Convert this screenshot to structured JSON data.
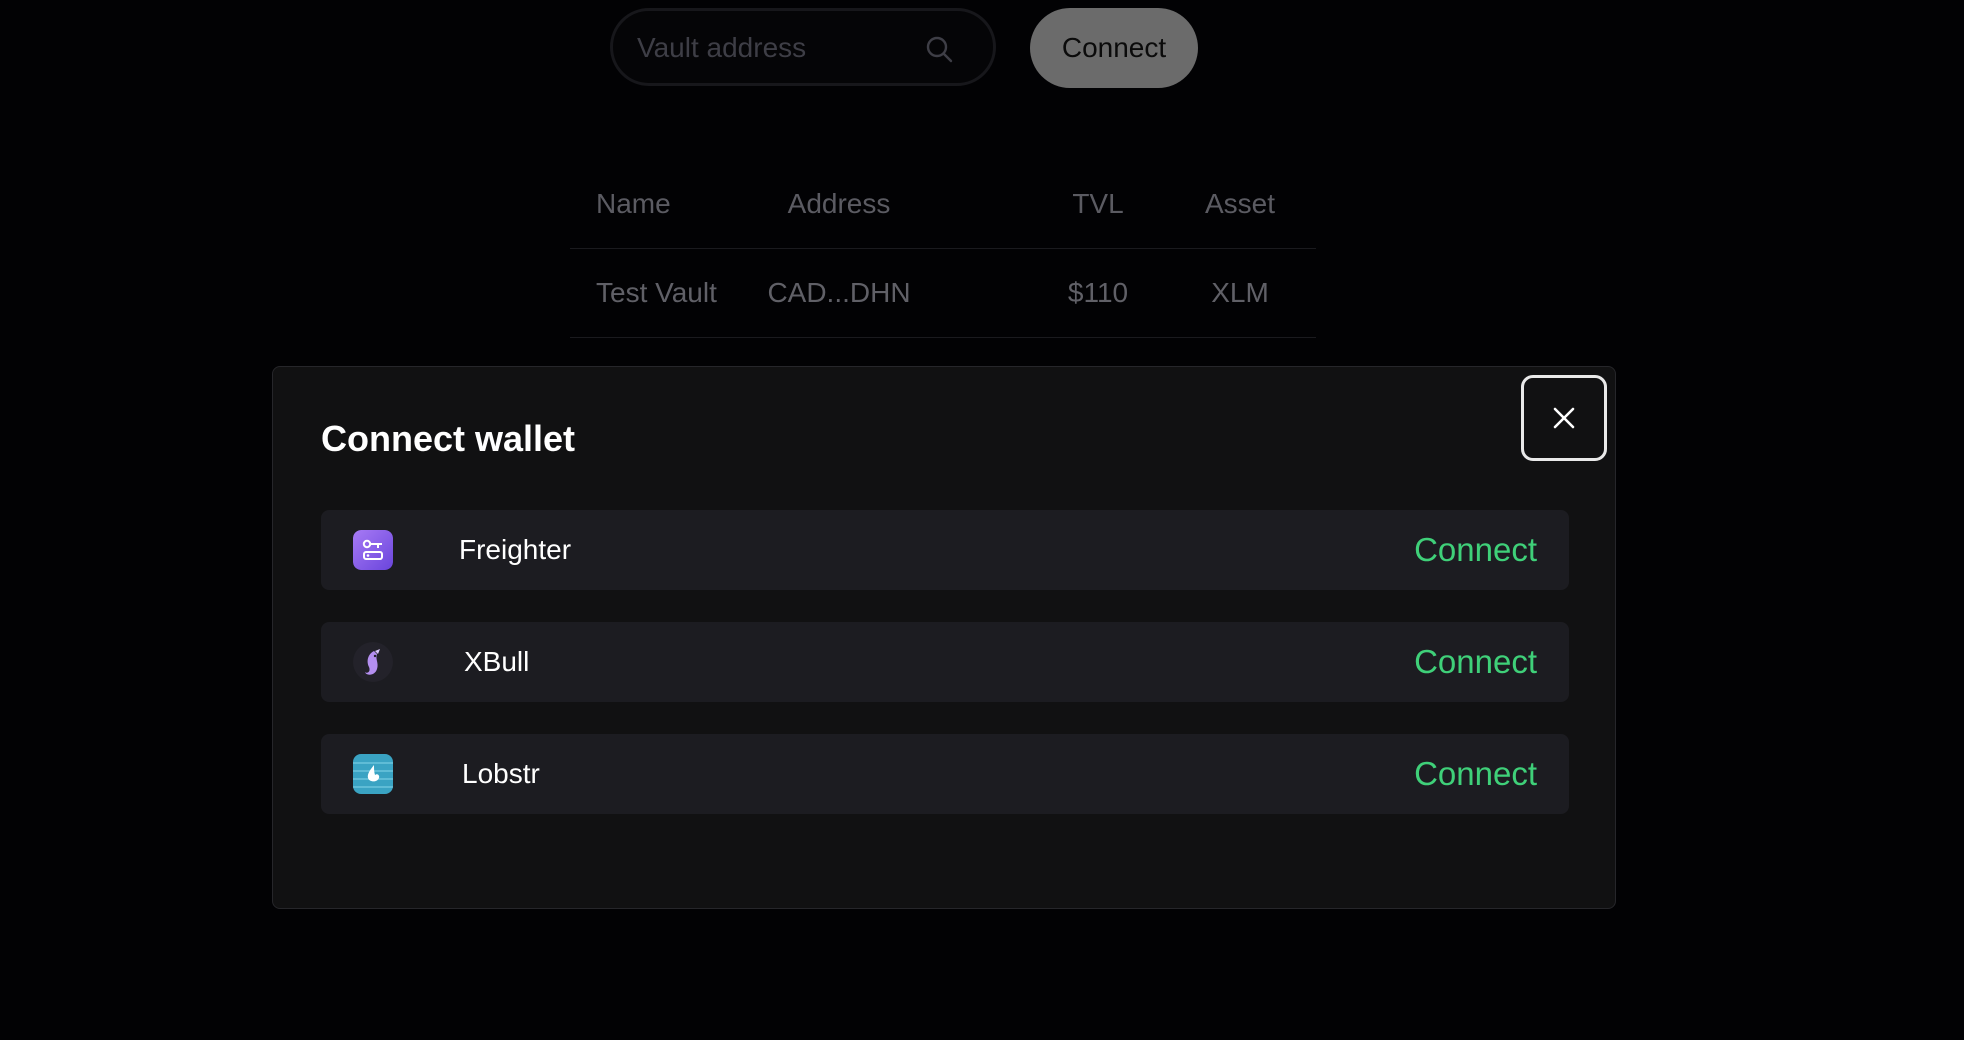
{
  "search": {
    "placeholder": "Vault address",
    "icon": "search-icon"
  },
  "top_connect_label": "Connect",
  "vault_table": {
    "columns": [
      "Name",
      "Address",
      "TVL",
      "Asset"
    ],
    "rows": [
      [
        "Test Vault",
        "CAD...DHN",
        "$110",
        "XLM"
      ]
    ]
  },
  "modal": {
    "title": "Connect wallet",
    "close_icon": "close-icon",
    "wallets": [
      {
        "name": "Freighter",
        "connect_label": "Connect",
        "icon": "freighter-icon"
      },
      {
        "name": "XBull",
        "connect_label": "Connect",
        "icon": "xbull-icon"
      },
      {
        "name": "Lobstr",
        "connect_label": "Connect",
        "icon": "lobstr-icon"
      }
    ]
  },
  "colors": {
    "background": "#020204",
    "modal_bg": "#111112",
    "row_bg": "#1c1c21",
    "accent_green": "#3fd079",
    "freighter_purple": "#8a5cf0",
    "lobstr_blue": "#3aa3c3"
  }
}
